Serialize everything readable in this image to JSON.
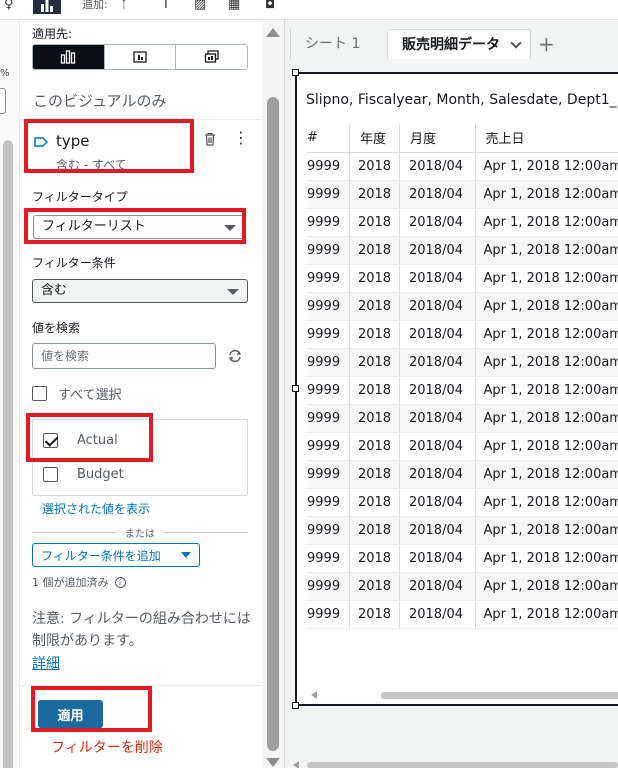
{
  "toolbar": {
    "add_label": "追加:"
  },
  "left_strip": {
    "percent_text": "%"
  },
  "filter_panel": {
    "apply_to_label": "適用先:",
    "scope_text": "このビジュアルのみ",
    "field": {
      "name": "type",
      "subtitle": "含む - すべて"
    },
    "filter_type_label": "フィルタータイプ",
    "filter_type_value": "フィルターリスト",
    "filter_condition_label": "フィルター条件",
    "filter_condition_value": "含む",
    "search_label": "値を検索",
    "search_placeholder": "値を検索",
    "select_all_label": "すべて選択",
    "values": [
      {
        "label": "Actual",
        "checked": true
      },
      {
        "label": "Budget",
        "checked": false
      }
    ],
    "show_selected_link": "選択された値を表示",
    "or_text": "または",
    "add_condition_button": "フィルター条件を追加",
    "added_count": "1 個が追加済み",
    "note_text": "注意: フィルターの組み合わせには制限があります。",
    "details_link": "詳細",
    "apply_button": "適用",
    "delete_filter_link": "フィルターを削除"
  },
  "sheets": {
    "tabs": [
      "シート 1",
      "販売明細データ"
    ],
    "active_tab": "販売明細データ"
  },
  "visual": {
    "title": "Slipno, Fiscalyear, Month, Salesdate, Dept1_",
    "columns": [
      "#",
      "年度",
      "月度",
      "売上日"
    ],
    "rows": [
      [
        "9999",
        "2018",
        "2018/04",
        "Apr 1, 2018 12:00am"
      ],
      [
        "9999",
        "2018",
        "2018/04",
        "Apr 1, 2018 12:00am"
      ],
      [
        "9999",
        "2018",
        "2018/04",
        "Apr 1, 2018 12:00am"
      ],
      [
        "9999",
        "2018",
        "2018/04",
        "Apr 1, 2018 12:00am"
      ],
      [
        "9999",
        "2018",
        "2018/04",
        "Apr 1, 2018 12:00am"
      ],
      [
        "9999",
        "2018",
        "2018/04",
        "Apr 1, 2018 12:00am"
      ],
      [
        "9999",
        "2018",
        "2018/04",
        "Apr 1, 2018 12:00am"
      ],
      [
        "9999",
        "2018",
        "2018/04",
        "Apr 1, 2018 12:00am"
      ],
      [
        "9999",
        "2018",
        "2018/04",
        "Apr 1, 2018 12:00am"
      ],
      [
        "9999",
        "2018",
        "2018/04",
        "Apr 1, 2018 12:00am"
      ],
      [
        "9999",
        "2018",
        "2018/04",
        "Apr 1, 2018 12:00am"
      ],
      [
        "9999",
        "2018",
        "2018/04",
        "Apr 1, 2018 12:00am"
      ],
      [
        "9999",
        "2018",
        "2018/04",
        "Apr 1, 2018 12:00am"
      ],
      [
        "9999",
        "2018",
        "2018/04",
        "Apr 1, 2018 12:00am"
      ],
      [
        "9999",
        "2018",
        "2018/04",
        "Apr 1, 2018 12:00am"
      ],
      [
        "9999",
        "2018",
        "2018/04",
        "Apr 1, 2018 12:00am"
      ],
      [
        "9999",
        "2018",
        "2018/04",
        "Apr 1, 2018 12:00am"
      ]
    ]
  },
  "colors": {
    "annotation_red": "#e01b24",
    "primary_button": "#1a6aa0",
    "link_blue": "#0073bb",
    "delete_red": "#d13212"
  },
  "icons": {
    "field_type": "dimension-tag-icon",
    "delete": "trash-icon",
    "more": "kebab-menu-icon",
    "refresh": "refresh-icon",
    "info": "info-icon"
  }
}
